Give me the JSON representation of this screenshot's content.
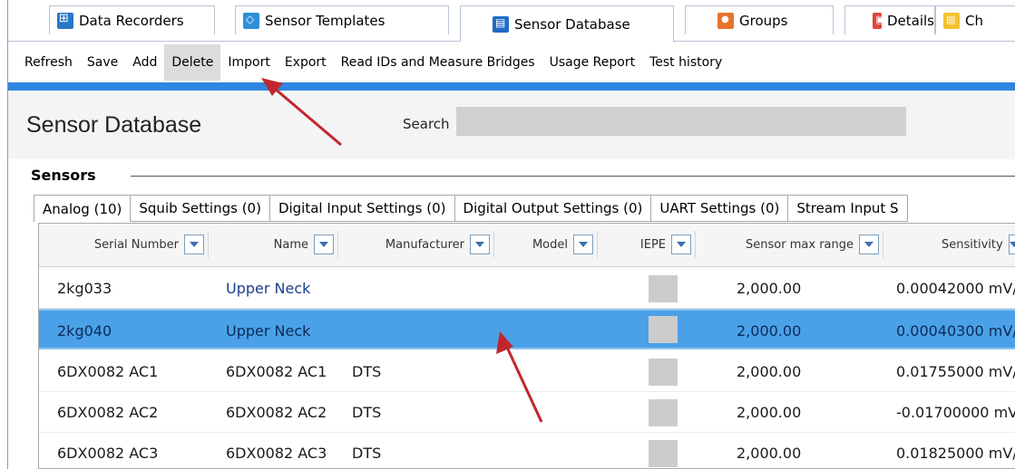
{
  "tabs": [
    {
      "label": "Data Recorders",
      "icon": "data-recorders-icon"
    },
    {
      "label": "Sensor Templates",
      "icon": "sensor-templates-icon"
    },
    {
      "label": "Sensor Database",
      "icon": "sensor-database-icon"
    },
    {
      "label": "Groups",
      "icon": "groups-icon"
    },
    {
      "label": "Details",
      "icon": "details-icon"
    },
    {
      "label": "Ch",
      "icon": "checkout-icon"
    }
  ],
  "toolbar": {
    "refresh": "Refresh",
    "save": "Save",
    "add": "Add",
    "delete": "Delete",
    "import": "Import",
    "export": "Export",
    "read_ids": "Read IDs and Measure Bridges",
    "usage_report": "Usage Report",
    "test_history": "Test history"
  },
  "header": {
    "title": "Sensor Database",
    "search_label": "Search",
    "search_value": ""
  },
  "sensors": {
    "title": "Sensors",
    "subtabs": [
      "Analog (10)",
      "Squib Settings (0)",
      "Digital Input Settings (0)",
      "Digital Output Settings (0)",
      "UART Settings (0)",
      "Stream Input S"
    ]
  },
  "grid": {
    "columns": [
      "Serial Number",
      "Name",
      "Manufacturer",
      "Model",
      "IEPE",
      "Sensor max range",
      "Sensitivity"
    ],
    "rows": [
      {
        "serial": "2kg033",
        "name": "Upper Neck",
        "manufacturer": "",
        "range": "2,000.00",
        "sensitivity": "0.00042000 mV/"
      },
      {
        "serial": "2kg040",
        "name": "Upper Neck",
        "manufacturer": "",
        "range": "2,000.00",
        "sensitivity": "0.00040300 mV/"
      },
      {
        "serial": "6DX0082 AC1",
        "name": "6DX0082 AC1",
        "manufacturer": "DTS",
        "range": "2,000.00",
        "sensitivity": "0.01755000 mV/"
      },
      {
        "serial": "6DX0082 AC2",
        "name": "6DX0082 AC2",
        "manufacturer": "DTS",
        "range": "2,000.00",
        "sensitivity": "-0.01700000 mV"
      },
      {
        "serial": "6DX0082 AC3",
        "name": "6DX0082 AC3",
        "manufacturer": "DTS",
        "range": "2,000.00",
        "sensitivity": "0.01825000 mV/"
      }
    ],
    "selected_row": 1
  },
  "colors": {
    "accent": "#2f86e0",
    "selected_row": "#4aa1e8",
    "annotation_arrow": "#c0272d"
  }
}
